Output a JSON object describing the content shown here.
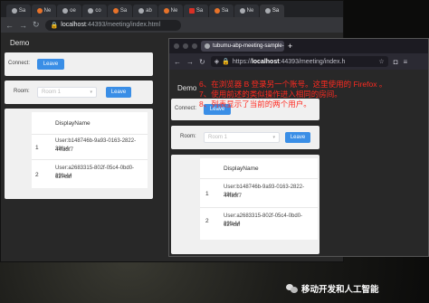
{
  "browser_a": {
    "tabs": [
      {
        "label": "Sa",
        "icon": "page-icon"
      },
      {
        "label": "Ne",
        "icon": "page-icon"
      },
      {
        "label": "oe",
        "icon": "github-icon"
      },
      {
        "label": "co",
        "icon": "github-icon"
      },
      {
        "label": "Sa",
        "icon": "page-icon"
      },
      {
        "label": "ab",
        "icon": "github-icon"
      },
      {
        "label": "Ne",
        "icon": "page-icon"
      },
      {
        "label": "Sa",
        "icon": "page-icon"
      },
      {
        "label": "Sa",
        "icon": "page-icon"
      },
      {
        "label": "Ne",
        "icon": "page-icon"
      },
      {
        "label": "Sa",
        "icon": "page-icon"
      }
    ],
    "url_host": "localhost",
    "url_rest": ":44393/meeting/index.html",
    "nav_title": "Demo",
    "connect_label": "Connect:",
    "connect_button": "Leave",
    "room_label": "Room:",
    "room_placeholder": "Room 1",
    "room_button": "Leave",
    "table": {
      "header": "DisplayName",
      "rows": [
        {
          "index": "1",
          "line1": "User:b148746b-9a93-0163-2822-39fa4",
          "line2": "44f33f7"
        },
        {
          "index": "2",
          "line1": "User:a2683315-802f-05c4-0bd0-39fa44",
          "line2": "627caf"
        }
      ]
    }
  },
  "browser_b": {
    "tab_title": "tubumu-abp-meeting-sample-clie",
    "url_scheme": "https://",
    "url_host": "localhost",
    "url_rest": ":44393/meeting/index.h",
    "nav_title": "Demo",
    "connect_label": "Connect:",
    "connect_button": "Leave",
    "room_label": "Room:",
    "room_placeholder": "Room 1",
    "room_button": "Leave",
    "table": {
      "header": "DisplayName",
      "rows": [
        {
          "index": "1",
          "line1": "User:b148746b-9a93-0163-2822-39fa4",
          "line2": "44f33f7"
        },
        {
          "index": "2",
          "line1": "User:a2683315-802f-05c4-0bd0-39fa44",
          "line2": "627caf"
        }
      ]
    }
  },
  "annotations": [
    "6、在浏览器 B 登录另一个账号。这里使用的 Firefox 。",
    "7、使用前述的类似操作进入相同的房间。",
    "8、列表显示了当前的两个用户。"
  ],
  "watermark": "移动开发和人工智能",
  "colors": {
    "accent": "#3a8ee6",
    "annotation": "#ff2a20",
    "content_bg": "#282828"
  }
}
